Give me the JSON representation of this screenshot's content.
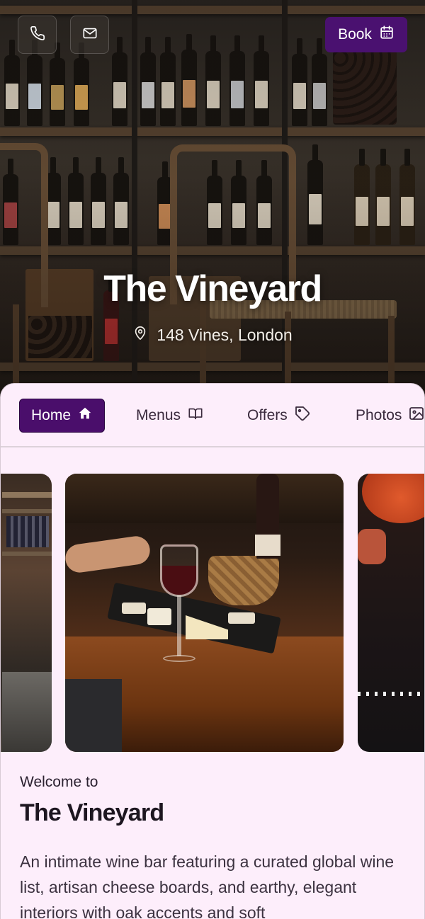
{
  "header": {
    "book_label": "Book",
    "phone_icon": "phone-icon",
    "mail_icon": "mail-icon",
    "calendar_icon": "calendar-icon"
  },
  "hero": {
    "title": "The Vineyard",
    "address": "148 Vines, London",
    "location_icon": "map-pin-icon"
  },
  "tabs": [
    {
      "label": "Home",
      "icon": "home-icon",
      "active": true
    },
    {
      "label": "Menus",
      "icon": "book-open-icon",
      "active": false
    },
    {
      "label": "Offers",
      "icon": "tag-icon",
      "active": false
    },
    {
      "label": "Photos",
      "icon": "image-icon",
      "active": false
    }
  ],
  "content": {
    "welcome": "Welcome to",
    "name": "The Vineyard",
    "description": "An intimate wine bar featuring a curated global wine list, artisan cheese boards, and earthy, elegant interiors with oak accents and soft"
  },
  "colors": {
    "accent": "#4a0e6b",
    "background": "#fdeefb"
  }
}
